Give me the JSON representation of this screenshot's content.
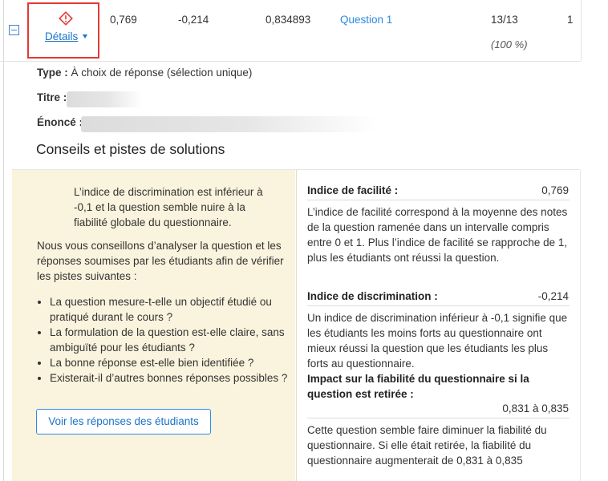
{
  "row": {
    "details_label": "Détails",
    "facility": "0,769",
    "discrimination": "-0,214",
    "reliability": "0,834893",
    "question_link": "Question 1",
    "score": "13/13",
    "score_pct": "(100 %)",
    "rank": "1"
  },
  "details": {
    "type_label": "Type :",
    "type_value": "À choix de réponse (sélection unique)",
    "title_label": "Titre :",
    "statement_label": "Énoncé :"
  },
  "advice": {
    "section_title": "Conseils et pistes de solutions",
    "intro": "L’indice de discrimination est inférieur à -0,1 et la question semble nuire à la fiabilité globale du questionnaire.",
    "recommendation": "Nous vous conseillons d’analyser la question et les réponses soumises par les étudiants afin de vérifier les pistes suivantes :",
    "tips": [
      "La question mesure-t-elle un objectif étudié ou pratiqué durant le cours ?",
      "La formulation de la question est-elle claire, sans ambiguïté pour les étudiants ?",
      "La bonne réponse est-elle bien identifiée ?",
      "Existerait-il d’autres bonnes réponses possibles ?"
    ],
    "button_label": "Voir les réponses des étudiants"
  },
  "indices": {
    "facility_heading": "Indice de facilité :",
    "facility_value": "0,769",
    "facility_text": "L’indice de facilité correspond à la moyenne des notes de la question ramenée dans un intervalle compris entre 0 et 1. Plus l’indice de facilité se rapproche de 1, plus les étudiants ont réussi la question.",
    "discrimination_heading": "Indice de discrimination :",
    "discrimination_value": "-0,214",
    "discrimination_text": "Un indice de discrimination inférieur à -0,1 signifie que les étudiants les moins forts au questionnaire ont mieux réussi la question que les étudiants les plus forts au questionnaire.",
    "impact_heading": "Impact sur la fiabilité du questionnaire si la question est retirée :",
    "impact_value": "0,831 à 0,835",
    "impact_text": "Cette question semble faire diminuer la fiabilité du questionnaire. Si elle était retirée, la fiabilité du questionnaire augmenterait de 0,831 à 0,835"
  },
  "colors": {
    "warning": "#e53935",
    "link": "#1a73c8",
    "advice_bg": "#faf3dd"
  },
  "icons": [
    "warning-diamond-icon",
    "collapse-icon",
    "caret-down-icon"
  ]
}
